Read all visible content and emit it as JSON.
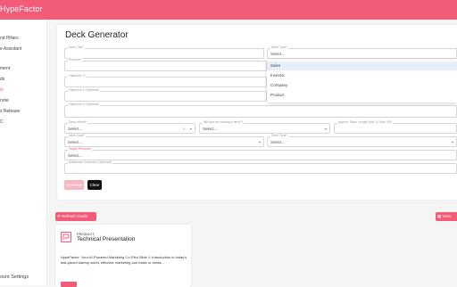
{
  "app": {
    "brand": "HypeFactor"
  },
  "sidebar": {
    "items": [
      {
        "label": "nd Pillars",
        "active": false
      },
      {
        "label": "e Assistant",
        "active": false
      },
      {
        "label": "ment",
        "active": false
      },
      {
        "label": "ds",
        "active": false
      },
      {
        "label": "ts",
        "active": true
      },
      {
        "label": "note",
        "active": false
      },
      {
        "label": "s Release",
        "active": false
      },
      {
        "label": "C",
        "active": false
      }
    ],
    "account": "ount Settings"
  },
  "form": {
    "title": "Deck Generator",
    "deck_title": {
      "label": "Deck Title*",
      "value": ""
    },
    "deck_type": {
      "label": "Deck Type*",
      "value": "Select...",
      "options": [
        "Sales",
        "Investor",
        "Company",
        "Product"
      ],
      "highlighted": "Sales"
    },
    "purpose": {
      "label": "Purpose*",
      "value": ""
    },
    "objective_1": {
      "label": "Objective 1*",
      "value": ""
    },
    "objective_2": {
      "label": "Objective 2 (Optional)",
      "value": ""
    },
    "objective_3": {
      "label": "Objective 3 (Optional)",
      "value": ""
    },
    "deck_model": {
      "label": "Deck Model*",
      "value": "Select..."
    },
    "writing_library": {
      "label": "Will you be sharing a deck?*",
      "value": "Select..."
    },
    "deck_length": {
      "label": "Approx. Deck Length (Min. 5, Max 30)*",
      "value": ""
    },
    "deck_goal": {
      "label": "Deck Goal*",
      "value": "Select..."
    },
    "deck_tone": {
      "label": "Deck Tone*",
      "value": "Select..."
    },
    "target_persona": {
      "label": "Target Persona*",
      "value": "Select..."
    },
    "additional_guidance": {
      "label": "Additional Guidance (Optional)",
      "value": ""
    },
    "generate_label": "Generate",
    "clear_label": "Clear"
  },
  "actions": {
    "refresh_label": "Refresh Cards",
    "view_label": "View"
  },
  "deck_card": {
    "category": "PRODUCT",
    "title": "Technical Presentation",
    "body": "HypeFactor: Your AI-Powered Marketing Co-Pilot Slide 1: Introduction in today's fast-paced startup world, effective marketing can make or break..."
  },
  "colors": {
    "accent": "#f25c78",
    "accent_light": "#f7b6c1",
    "dark_button": "#111111",
    "dropdown_highlight": "#e8eef9"
  }
}
